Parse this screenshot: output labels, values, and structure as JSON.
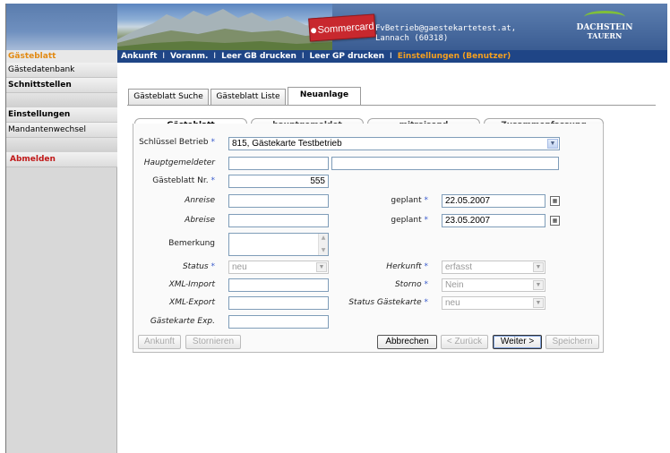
{
  "header": {
    "badge_text": "Sommercard",
    "account_line1": "FvBetrieb@gaestekartetest.at,",
    "account_line2": "Lannach (60318)",
    "logo_line1": "DACHSTEIN",
    "logo_line2": "TAUERN"
  },
  "nav": {
    "active_left": "Gästeblatt",
    "items": [
      "Ankunft",
      "Voranm.",
      "Leer GB drucken",
      "Leer GP drucken",
      "Einstellungen (Benutzer)"
    ],
    "separator": "I"
  },
  "sidebar": {
    "items": [
      "Gästedatenbank",
      "Schnittstellen",
      "Einstellungen",
      "Mandantenwechsel",
      "Abmelden"
    ]
  },
  "tabs": [
    "Gästeblatt Suche",
    "Gästeblatt Liste",
    "Neuanlage"
  ],
  "subtabs": [
    "Gästeblatt",
    "hauptgemeldet",
    "mitreisend",
    "Zusammenfassung"
  ],
  "form": {
    "schluessel_label": "Schlüssel Betrieb",
    "schluessel_value": "815, Gästekarte Testbetrieb",
    "hauptgemeldeter_label": "Hauptgemeldeter",
    "gaesteblatt_nr_label": "Gästeblatt Nr.",
    "gaesteblatt_nr_value": "555",
    "anreise_label": "Anreise",
    "abreise_label": "Abreise",
    "geplant_label": "geplant",
    "geplant_anreise": "22.05.2007",
    "geplant_abreise": "23.05.2007",
    "bemerkung_label": "Bemerkung",
    "status_label": "Status",
    "status_value": "neu",
    "herkunft_label": "Herkunft",
    "herkunft_value": "erfasst",
    "xml_import_label": "XML-Import",
    "storno_label": "Storno",
    "storno_value": "Nein",
    "xml_export_label": "XML-Export",
    "status_gk_label": "Status Gästekarte",
    "status_gk_value": "neu",
    "gk_exp_label": "Gästekarte Exp."
  },
  "buttons": {
    "ankunft": "Ankunft",
    "stornieren": "Stornieren",
    "abbrechen": "Abbrechen",
    "zurueck": "< Zurück",
    "weiter": "Weiter >",
    "speichern": "Speichern"
  },
  "required_mark": "*",
  "colors": {
    "nav_bg": "#1f4586",
    "accent_orange": "#e28a13",
    "logout_red": "#c01818",
    "badge_red": "#c8282e"
  }
}
